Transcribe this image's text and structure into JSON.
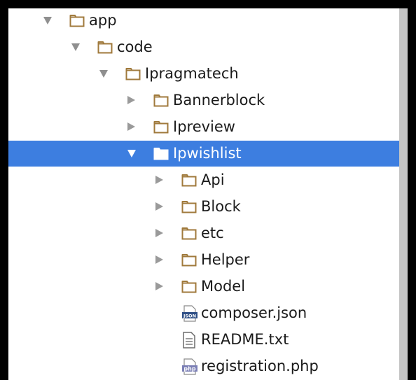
{
  "tree": {
    "items": [
      {
        "label": "app",
        "depth": 0,
        "state": "open",
        "icon": "folder-icon",
        "selected": false
      },
      {
        "label": "code",
        "depth": 1,
        "state": "open",
        "icon": "folder-icon",
        "selected": false
      },
      {
        "label": "Ipragmatech",
        "depth": 2,
        "state": "open",
        "icon": "folder-icon",
        "selected": false
      },
      {
        "label": "Bannerblock",
        "depth": 3,
        "state": "closed",
        "icon": "folder-icon",
        "selected": false
      },
      {
        "label": "Ipreview",
        "depth": 3,
        "state": "closed",
        "icon": "folder-icon",
        "selected": false
      },
      {
        "label": "Ipwishlist",
        "depth": 3,
        "state": "open",
        "icon": "folder-icon",
        "selected": true
      },
      {
        "label": "Api",
        "depth": 4,
        "state": "closed",
        "icon": "folder-icon",
        "selected": false
      },
      {
        "label": "Block",
        "depth": 4,
        "state": "closed",
        "icon": "folder-icon",
        "selected": false
      },
      {
        "label": "etc",
        "depth": 4,
        "state": "closed",
        "icon": "folder-icon",
        "selected": false
      },
      {
        "label": "Helper",
        "depth": 4,
        "state": "closed",
        "icon": "folder-icon",
        "selected": false
      },
      {
        "label": "Model",
        "depth": 4,
        "state": "closed",
        "icon": "folder-icon",
        "selected": false
      },
      {
        "label": "composer.json",
        "depth": 4,
        "state": "leaf",
        "icon": "json-file-icon",
        "icon_text": "JSON",
        "selected": false
      },
      {
        "label": "README.txt",
        "depth": 4,
        "state": "leaf",
        "icon": "text-file-icon",
        "selected": false
      },
      {
        "label": "registration.php",
        "depth": 4,
        "state": "leaf",
        "icon": "php-file-icon",
        "icon_text": "php",
        "selected": false
      }
    ]
  },
  "colors": {
    "selection": "#3d7ee0",
    "folder_stroke": "#a07a3c",
    "json_badge": "#2f4f86",
    "php_badge": "#7b7fb5"
  }
}
